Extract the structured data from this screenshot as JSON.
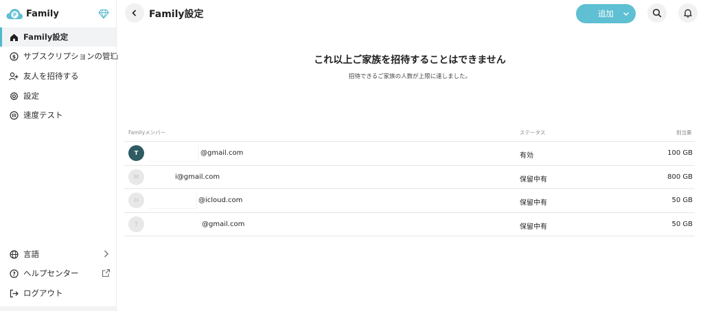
{
  "brand": {
    "name": "Family",
    "logo_icon": "p-cloud-logo-icon",
    "badge_icon": "diamond-icon",
    "accent": "#5fbfd3"
  },
  "sidebar": {
    "items": [
      {
        "label": "Family設定",
        "icon": "home-icon",
        "active": true
      },
      {
        "label": "サブスクリプションの管理",
        "icon": "dollar-circle-icon",
        "trail_icon": "external-link-icon"
      },
      {
        "label": "友人を招待する",
        "icon": "add-user-icon"
      },
      {
        "label": "設定",
        "icon": "gear-icon"
      },
      {
        "label": "速度テスト",
        "icon": "speedometer-icon"
      }
    ],
    "bottom_items": [
      {
        "label": "言語",
        "icon": "globe-icon",
        "trail_icon": "chevron-right-icon"
      },
      {
        "label": "ヘルプセンター",
        "icon": "help-circle-icon",
        "trail_icon": "external-link-icon"
      },
      {
        "label": "ログアウト",
        "icon": "logout-icon"
      }
    ]
  },
  "header": {
    "title": "Family設定",
    "add_button_label": "追加"
  },
  "message": {
    "title": "これ以上ご家族を招待することはできません",
    "subtitle": "招待できるご家族の人数が上限に達しました。"
  },
  "table": {
    "columns": {
      "member": "Familyメンバー",
      "status": "ステータス",
      "quota": "割当量"
    },
    "rows": [
      {
        "initial": "T",
        "email": "@gmail.com",
        "status": "有効",
        "quota": "100 GB",
        "state": "active"
      },
      {
        "initial": "M",
        "email": "i@gmail.com",
        "status": "保留中有",
        "quota": "800 GB",
        "state": "pending"
      },
      {
        "initial": "H",
        "email": "@icloud.com",
        "status": "保留中有",
        "quota": "50 GB",
        "state": "pending"
      },
      {
        "initial": "T",
        "email": "@gmail.com",
        "status": "保留中有",
        "quota": "50 GB",
        "state": "pending"
      }
    ]
  }
}
